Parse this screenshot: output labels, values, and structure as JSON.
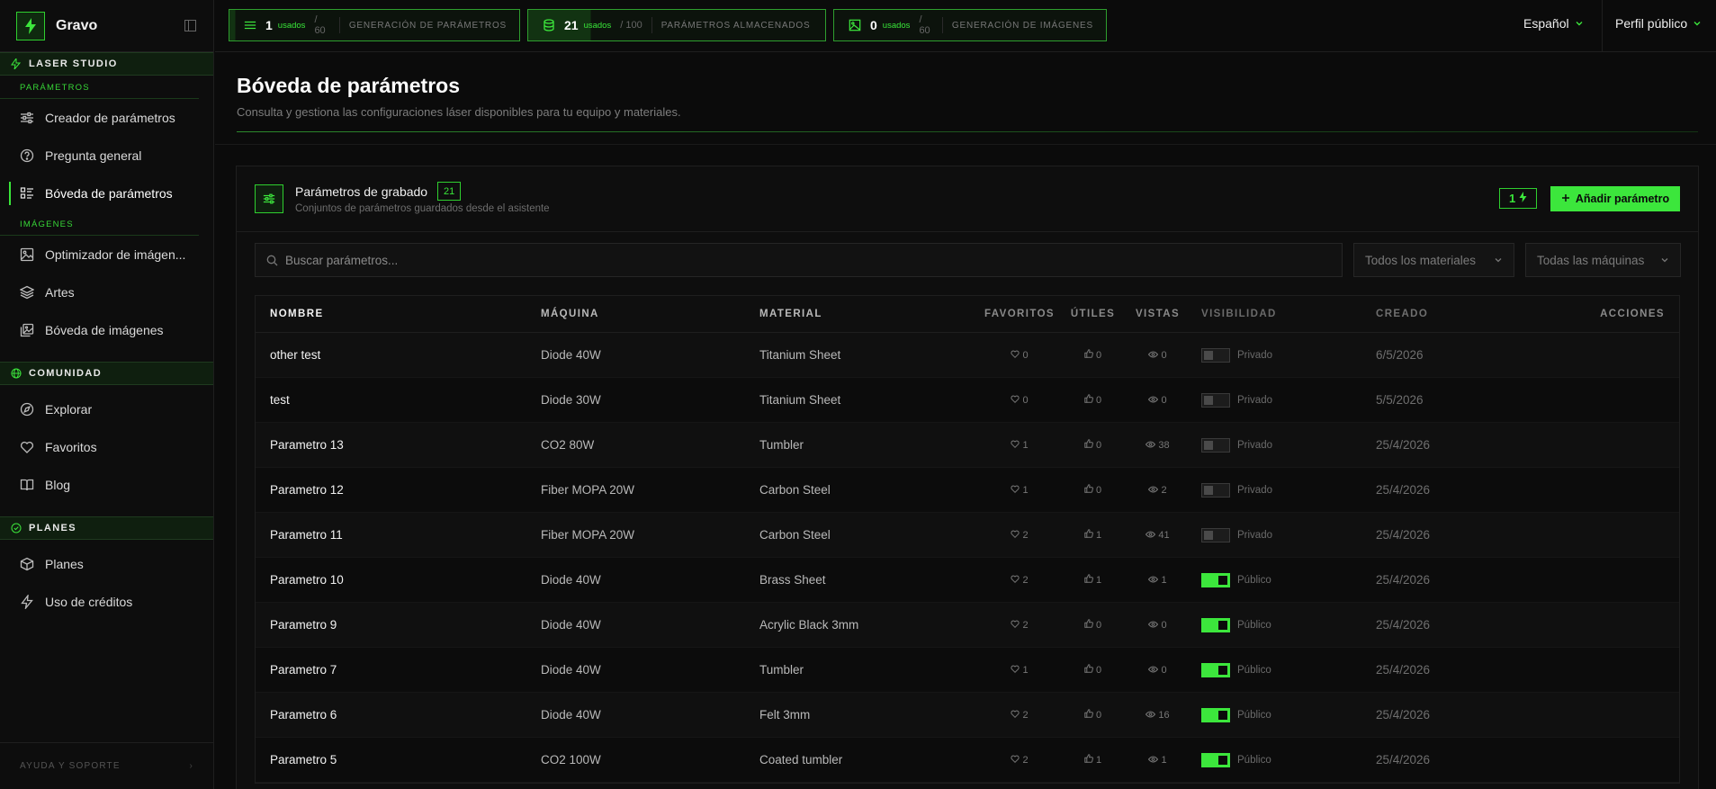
{
  "brand": {
    "name": "Gravo"
  },
  "topbar": {
    "usage": [
      {
        "value": "1",
        "used_label": "usados",
        "total": "/ 60",
        "label": "GENERACIÓN DE PARÁMETROS",
        "fill": 0.017
      },
      {
        "value": "21",
        "used_label": "usados",
        "total": "/ 100",
        "label": "PARÁMETROS ALMACENADOS",
        "fill": 0.21
      },
      {
        "value": "0",
        "used_label": "usados",
        "total": "/ 60",
        "label": "GENERACIÓN DE IMÁGENES",
        "fill": 0
      }
    ],
    "language": "Español",
    "profile": "Perfil público"
  },
  "sidebar": {
    "laser_studio": "LASER STUDIO",
    "params_heading": "PARÁMETROS",
    "params_items": [
      {
        "label": "Creador de parámetros",
        "icon": "sliders-icon"
      },
      {
        "label": "Pregunta general",
        "icon": "help-circle-icon"
      },
      {
        "label": "Bóveda de parámetros",
        "icon": "vault-list-icon",
        "active": true
      }
    ],
    "images_heading": "IMÁGENES",
    "images_items": [
      {
        "label": "Optimizador de imágen...",
        "icon": "image-icon"
      },
      {
        "label": "Artes",
        "icon": "layers-icon"
      },
      {
        "label": "Bóveda de imágenes",
        "icon": "images-icon"
      }
    ],
    "community": "COMUNIDAD",
    "community_items": [
      {
        "label": "Explorar",
        "icon": "compass-icon"
      },
      {
        "label": "Favoritos",
        "icon": "heart-icon"
      },
      {
        "label": "Blog",
        "icon": "book-icon"
      }
    ],
    "plans": "PLANES",
    "plans_items": [
      {
        "label": "Planes",
        "icon": "package-icon"
      },
      {
        "label": "Uso de créditos",
        "icon": "zap-icon"
      }
    ],
    "footer": "AYUDA Y SOPORTE"
  },
  "page": {
    "title": "Bóveda de parámetros",
    "subtitle": "Consulta y gestiona las configuraciones láser disponibles para tu equipo y materiales."
  },
  "card": {
    "title": "Parámetros de grabado",
    "count": "21",
    "subtitle": "Conjuntos de parámetros guardados desde el asistente",
    "credits": "1",
    "add_label": "Añadir parámetro",
    "search_placeholder": "Buscar parámetros...",
    "filter_materials": "Todos los materiales",
    "filter_machines": "Todas las máquinas"
  },
  "table": {
    "headers": {
      "name": "NOMBRE",
      "machine": "MÁQUINA",
      "material": "MATERIAL",
      "favorites": "FAVORITOS",
      "useful": "ÚTILES",
      "views": "VISTAS",
      "visibility": "VISIBILIDAD",
      "created": "CREADO",
      "actions": "ACCIONES"
    },
    "rows": [
      {
        "name": "other test",
        "machine": "Diode 40W",
        "material": "Titanium Sheet",
        "favorites": "0",
        "useful": "0",
        "views": "0",
        "public": false,
        "visibility": "Privado",
        "created": "6/5/2026"
      },
      {
        "name": "test",
        "machine": "Diode 30W",
        "material": "Titanium Sheet",
        "favorites": "0",
        "useful": "0",
        "views": "0",
        "public": false,
        "visibility": "Privado",
        "created": "5/5/2026"
      },
      {
        "name": "Parametro 13",
        "machine": "CO2 80W",
        "material": "Tumbler",
        "favorites": "1",
        "useful": "0",
        "views": "38",
        "public": false,
        "visibility": "Privado",
        "created": "25/4/2026"
      },
      {
        "name": "Parametro 12",
        "machine": "Fiber MOPA 20W",
        "material": "Carbon Steel",
        "favorites": "1",
        "useful": "0",
        "views": "2",
        "public": false,
        "visibility": "Privado",
        "created": "25/4/2026"
      },
      {
        "name": "Parametro 11",
        "machine": "Fiber MOPA 20W",
        "material": "Carbon Steel",
        "favorites": "2",
        "useful": "1",
        "views": "41",
        "public": false,
        "visibility": "Privado",
        "created": "25/4/2026"
      },
      {
        "name": "Parametro 10",
        "machine": "Diode 40W",
        "material": "Brass Sheet",
        "favorites": "2",
        "useful": "1",
        "views": "1",
        "public": true,
        "visibility": "Público",
        "created": "25/4/2026"
      },
      {
        "name": "Parametro 9",
        "machine": "Diode 40W",
        "material": "Acrylic Black 3mm",
        "favorites": "2",
        "useful": "0",
        "views": "0",
        "public": true,
        "visibility": "Público",
        "created": "25/4/2026"
      },
      {
        "name": "Parametro 7",
        "machine": "Diode 40W",
        "material": "Tumbler",
        "favorites": "1",
        "useful": "0",
        "views": "0",
        "public": true,
        "visibility": "Público",
        "created": "25/4/2026"
      },
      {
        "name": "Parametro 6",
        "machine": "Diode 40W",
        "material": "Felt 3mm",
        "favorites": "2",
        "useful": "0",
        "views": "16",
        "public": true,
        "visibility": "Público",
        "created": "25/4/2026"
      },
      {
        "name": "Parametro 5",
        "machine": "CO2 100W",
        "material": "Coated tumbler",
        "favorites": "2",
        "useful": "1",
        "views": "1",
        "public": true,
        "visibility": "Público",
        "created": "25/4/2026"
      }
    ]
  },
  "colors": {
    "accent": "#3ce63c",
    "background": "#0b0b0b",
    "border": "#1f1f1f"
  }
}
